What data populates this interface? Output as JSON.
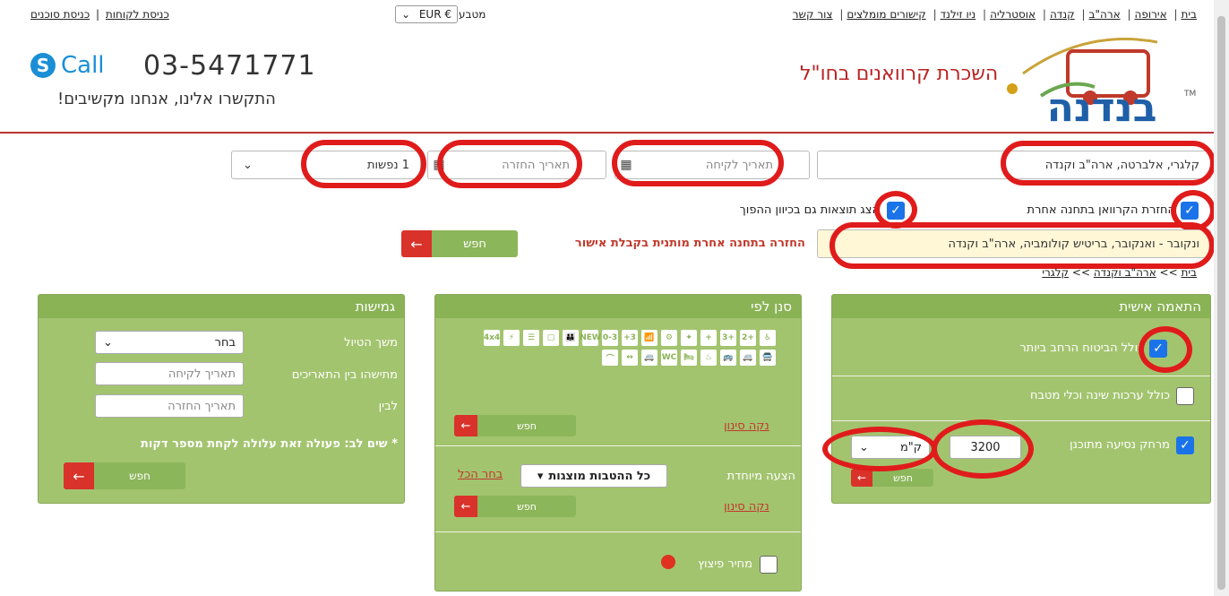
{
  "topnav": [
    "בית",
    "אירופה",
    "ארה\"ב",
    "קנדה",
    "אוסטרליה",
    "ניו זילנד",
    "קישורים מומלצים",
    "צור קשר"
  ],
  "currency": {
    "label": "מטבע",
    "value": "EUR €"
  },
  "login": {
    "agents": "כניסת סוכנים",
    "customers": "כניסת לקוחות"
  },
  "contact": {
    "call": "Call",
    "phone": "03-5471771",
    "tagline": "התקשרו אלינו, אנחנו מקשיבים!"
  },
  "site": {
    "title": "השכרת קרוואנים בחו\"ל",
    "logo_text": "בנדנה",
    "logo_tm": "TM"
  },
  "search": {
    "location": "קלגרי, אלברטה, ארה\"ב וקנדה",
    "pickup_placeholder": "תאריך לקיחה",
    "return_placeholder": "תאריך החזרה",
    "people": "1 נפשות",
    "return_other": "החזרת הקרוואן בתחנה אחרת",
    "reverse": "הצג תוצאות גם בכיוון ההפוך",
    "return_location": "ונקובר - ואנקובר, בריטיש קולומביה, ארה\"ב וקנדה",
    "warning": "החזרה בתחנה אחרת מותנית בקבלת אישור",
    "button": "חפש"
  },
  "breadcrumb": {
    "home": "בית",
    "sep": ">>",
    "country": "ארה\"ב וקנדה",
    "city": "קלגרי"
  },
  "personal": {
    "title": "התאמה אישית",
    "opt1": "כולל הביטוח הרחב ביותר",
    "opt2": "כולל ערכות שינה וכלי מטבח",
    "opt3": "מרחק נסיעה מתוכנן",
    "distance": "3200",
    "unit": "ק\"מ",
    "button": "חפש"
  },
  "filter": {
    "title": "סנן לפי",
    "clear": "נקה סינון",
    "button": "חפש",
    "special_label": "הצעה מיוחדת",
    "special_value": "כל ההטבות מוצגות",
    "select_all": "בחר הכל",
    "compensation": "מחיר פיצוץ",
    "icons": [
      "4x4",
      "⚡",
      "☰",
      "▢",
      "👪",
      "NEW",
      "0-3",
      "+3",
      "📶",
      "⚙",
      "✦",
      "+",
      "3+",
      "2+",
      "♿",
      "⌒",
      "↔",
      "🚐",
      "WC",
      "🛏",
      "♨",
      "🚌",
      "🚐",
      "🚍"
    ]
  },
  "flex": {
    "title": "גמישות",
    "duration_label": "משך הטיול",
    "duration_value": "בחר",
    "between_label": "מתישהו בין התאריכים",
    "from_placeholder": "תאריך לקיחה",
    "to_label": "לבין",
    "to_placeholder": "תאריך החזרה",
    "note": "* שים לב: פעולה זאת עלולה לקחת מספר דקות",
    "button": "חפש"
  }
}
